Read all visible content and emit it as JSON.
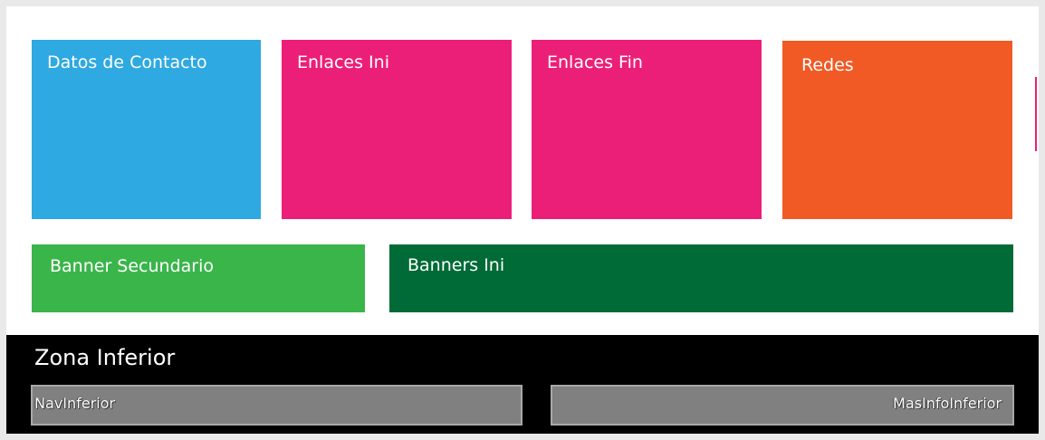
{
  "blocks": {
    "datos_contacto": {
      "label": "Datos de Contacto",
      "color": "#2ea9e1"
    },
    "enlaces_ini": {
      "label": "Enlaces Ini",
      "color": "#ec1f78"
    },
    "enlaces_fin": {
      "label": "Enlaces Fin",
      "color": "#ec1f78"
    },
    "redes": {
      "label": "Redes",
      "color": "#f15a24"
    },
    "banner_secundario": {
      "label": "Banner Secundario",
      "color": "#3ab54a"
    },
    "banners_ini": {
      "label": "Banners Ini",
      "color": "#006b36"
    }
  },
  "zona_inferior": {
    "title": "Zona Inferior",
    "color": "#000000",
    "nav_inferior": {
      "label": "NavInferior",
      "color": "#808080"
    },
    "mas_info_inferior": {
      "label": "MasInfoInferior",
      "color": "#808080"
    }
  }
}
